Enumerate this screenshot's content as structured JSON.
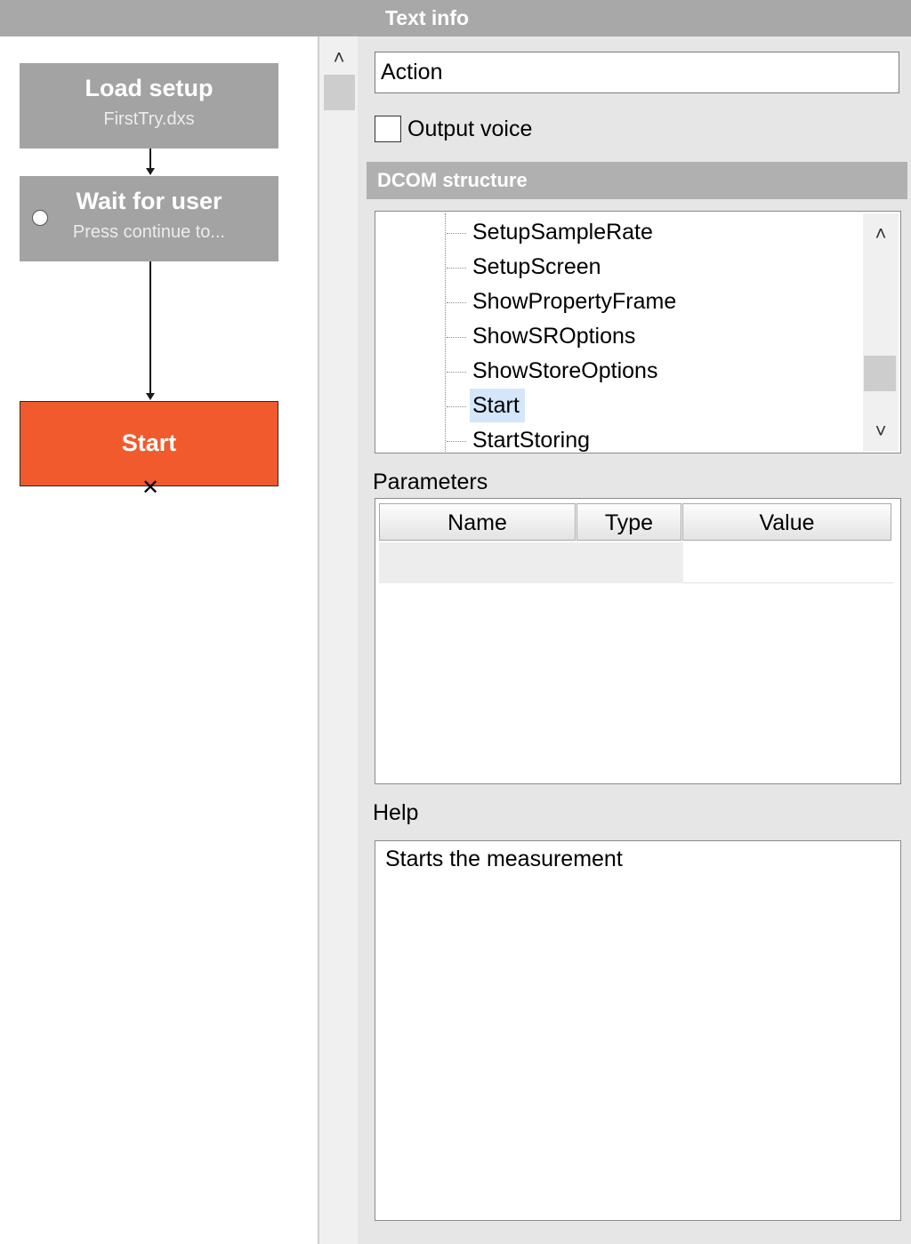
{
  "header": {
    "title": "Text info"
  },
  "flow": {
    "nodes": [
      {
        "title": "Load setup",
        "subtitle": "FirstTry.dxs"
      },
      {
        "title": "Wait for user",
        "subtitle": "Press continue to..."
      },
      {
        "title": "Start",
        "subtitle": ""
      }
    ],
    "colors": {
      "node": "#a3a3a3",
      "active_node": "#f05a2c"
    }
  },
  "action": {
    "value": "Action"
  },
  "output_voice": {
    "label": "Output voice",
    "checked": false
  },
  "dcom": {
    "title": "DCOM structure",
    "items": [
      "SetupSampleRate",
      "SetupScreen",
      "ShowPropertyFrame",
      "ShowSROptions",
      "ShowStoreOptions",
      "Start",
      "StartStoring"
    ],
    "selected": "Start"
  },
  "parameters": {
    "label": "Parameters",
    "columns": [
      "Name",
      "Type",
      "Value"
    ]
  },
  "help": {
    "label": "Help",
    "text": "Starts the measurement"
  },
  "icons": {
    "scroll_up": "˄",
    "scroll_down": "˅",
    "end_marker": "✕"
  }
}
